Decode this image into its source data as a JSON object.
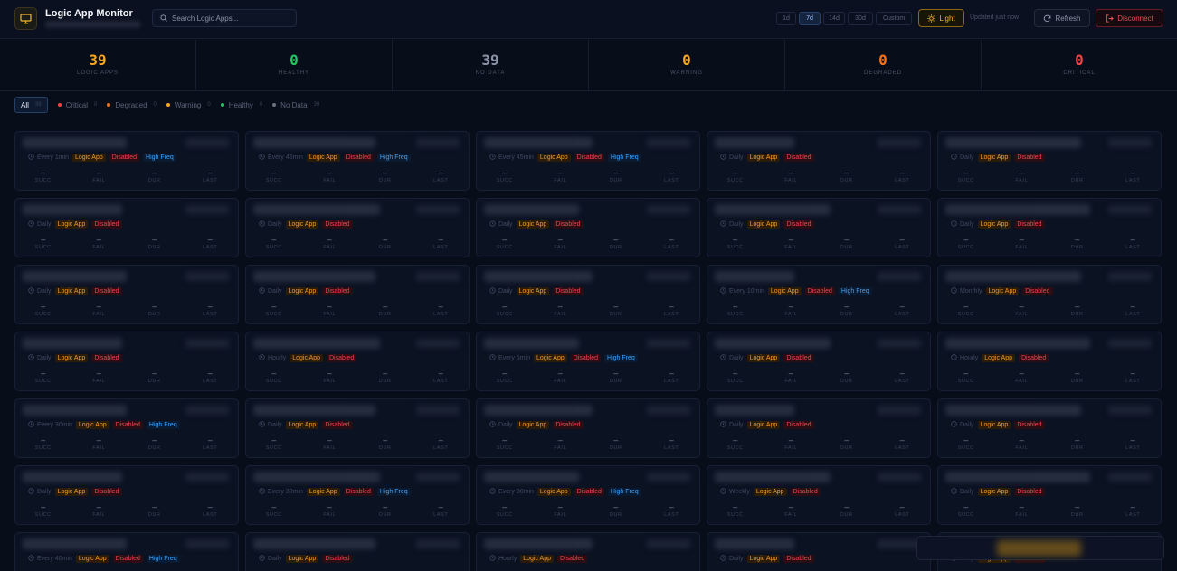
{
  "header": {
    "app_title": "Logic App Monitor",
    "search_placeholder": "Search Logic Apps...",
    "ranges": [
      {
        "label": "1d",
        "active": false
      },
      {
        "label": "7d",
        "active": true
      },
      {
        "label": "14d",
        "active": false
      },
      {
        "label": "30d",
        "active": false
      },
      {
        "label": "Custom",
        "active": false
      }
    ],
    "theme_label": "Light",
    "updated_text": "Updated just now",
    "refresh_label": "Refresh",
    "disconnect_label": "Disconnect"
  },
  "stats": [
    {
      "value": "39",
      "label": "LOGIC APPS",
      "color": "#f5a623"
    },
    {
      "value": "0",
      "label": "HEALTHY",
      "color": "#22c55e"
    },
    {
      "value": "39",
      "label": "NO DATA",
      "color": "#8a93a6"
    },
    {
      "value": "0",
      "label": "WARNING",
      "color": "#f5a623"
    },
    {
      "value": "0",
      "label": "DEGRADED",
      "color": "#f97316"
    },
    {
      "value": "0",
      "label": "CRITICAL",
      "color": "#ef4444"
    }
  ],
  "filters": [
    {
      "label": "All",
      "count": "39",
      "color": "",
      "active": true
    },
    {
      "label": "Critical",
      "count": "0",
      "color": "#ef4444",
      "active": false
    },
    {
      "label": "Degraded",
      "count": "0",
      "color": "#f97316",
      "active": false
    },
    {
      "label": "Warning",
      "count": "0",
      "color": "#f5a623",
      "active": false
    },
    {
      "label": "Healthy",
      "count": "0",
      "color": "#22c55e",
      "active": false
    },
    {
      "label": "No Data",
      "count": "39",
      "color": "#6b7280",
      "active": false
    }
  ],
  "metric_labels": [
    "SUCC",
    "FAIL",
    "DUR",
    "LAST"
  ],
  "metric_value": "–",
  "tag_labels": {
    "logic_app": "Logic App",
    "disabled": "Disabled",
    "high_freq": "High Freq"
  },
  "cards": [
    {
      "schedule": "Every 1min",
      "high_freq": true
    },
    {
      "schedule": "Every 45min",
      "high_freq": true
    },
    {
      "schedule": "Every 45min",
      "high_freq": true
    },
    {
      "schedule": "Daily",
      "high_freq": false
    },
    {
      "schedule": "Daily",
      "high_freq": false
    },
    {
      "schedule": "Daily",
      "high_freq": false
    },
    {
      "schedule": "Daily",
      "high_freq": false
    },
    {
      "schedule": "Daily",
      "high_freq": false
    },
    {
      "schedule": "Daily",
      "high_freq": false
    },
    {
      "schedule": "Daily",
      "high_freq": false
    },
    {
      "schedule": "Daily",
      "high_freq": false
    },
    {
      "schedule": "Daily",
      "high_freq": false
    },
    {
      "schedule": "Daily",
      "high_freq": false
    },
    {
      "schedule": "Every 10min",
      "high_freq": true
    },
    {
      "schedule": "Monthly",
      "high_freq": false
    },
    {
      "schedule": "Daily",
      "high_freq": false
    },
    {
      "schedule": "Hourly",
      "high_freq": false
    },
    {
      "schedule": "Every 5min",
      "high_freq": true
    },
    {
      "schedule": "Daily",
      "high_freq": false
    },
    {
      "schedule": "Hourly",
      "high_freq": false
    },
    {
      "schedule": "Every 30min",
      "high_freq": true
    },
    {
      "schedule": "Daily",
      "high_freq": false
    },
    {
      "schedule": "Daily",
      "high_freq": false
    },
    {
      "schedule": "Daily",
      "high_freq": false
    },
    {
      "schedule": "Daily",
      "high_freq": false
    },
    {
      "schedule": "Daily",
      "high_freq": false
    },
    {
      "schedule": "Every 30min",
      "high_freq": true
    },
    {
      "schedule": "Every 30min",
      "high_freq": true
    },
    {
      "schedule": "Weekly",
      "high_freq": false
    },
    {
      "schedule": "Daily",
      "high_freq": false
    },
    {
      "schedule": "Every 40min",
      "high_freq": true
    },
    {
      "schedule": "Daily",
      "high_freq": false
    },
    {
      "schedule": "Hourly",
      "high_freq": false
    },
    {
      "schedule": "Daily",
      "high_freq": false
    },
    {
      "schedule": "Daily",
      "high_freq": false
    }
  ]
}
